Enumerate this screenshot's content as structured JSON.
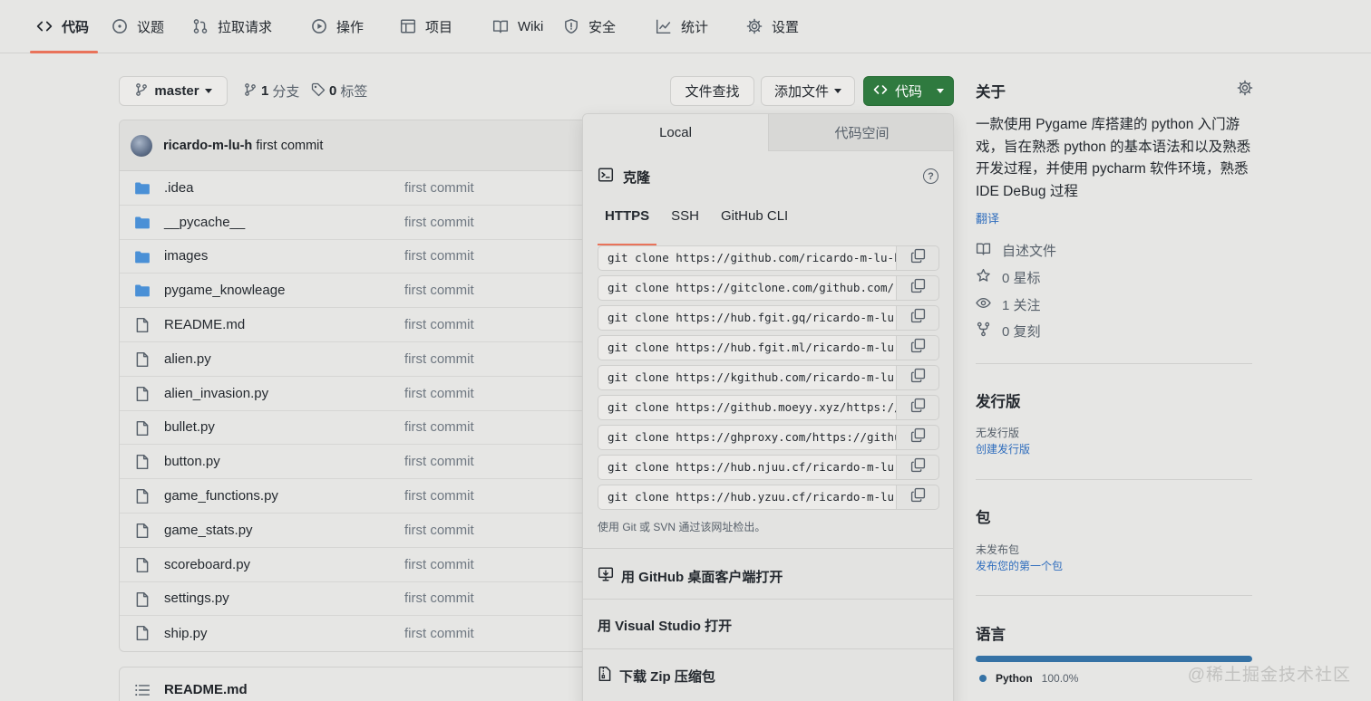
{
  "nav": {
    "tabs": [
      {
        "label": "代码",
        "icon": "code-icon",
        "active": true
      },
      {
        "label": "议题",
        "icon": "issue-icon"
      },
      {
        "label": "拉取请求",
        "icon": "pull-request-icon"
      },
      {
        "label": "操作",
        "icon": "play-icon"
      },
      {
        "label": "项目",
        "icon": "table-icon"
      },
      {
        "label": "Wiki",
        "icon": "book-icon"
      },
      {
        "label": "安全",
        "icon": "shield-icon"
      },
      {
        "label": "统计",
        "icon": "graph-icon"
      },
      {
        "label": "设置",
        "icon": "gear-icon"
      }
    ],
    "accent": "#e9735a"
  },
  "branchbar": {
    "branch": "master",
    "branches_count": "1",
    "branches_label": "分支",
    "tags_count": "0",
    "tags_label": "标签",
    "find_file": "文件查找",
    "add_file": "添加文件",
    "code_button": "代码"
  },
  "commit": {
    "author": "ricardo-m-lu-h",
    "message": "first commit"
  },
  "files": [
    {
      "name": ".idea",
      "type": "folder",
      "message": "first commit"
    },
    {
      "name": "__pycache__",
      "type": "folder",
      "message": "first commit"
    },
    {
      "name": "images",
      "type": "folder",
      "message": "first commit"
    },
    {
      "name": "pygame_knowleage",
      "type": "folder",
      "message": "first commit"
    },
    {
      "name": "README.md",
      "type": "file",
      "message": "first commit"
    },
    {
      "name": "alien.py",
      "type": "file",
      "message": "first commit"
    },
    {
      "name": "alien_invasion.py",
      "type": "file",
      "message": "first commit"
    },
    {
      "name": "bullet.py",
      "type": "file",
      "message": "first commit"
    },
    {
      "name": "button.py",
      "type": "file",
      "message": "first commit"
    },
    {
      "name": "game_functions.py",
      "type": "file",
      "message": "first commit"
    },
    {
      "name": "game_stats.py",
      "type": "file",
      "message": "first commit"
    },
    {
      "name": "scoreboard.py",
      "type": "file",
      "message": "first commit"
    },
    {
      "name": "settings.py",
      "type": "file",
      "message": "first commit"
    },
    {
      "name": "ship.py",
      "type": "file",
      "message": "first commit"
    }
  ],
  "readme": {
    "title": "README.md"
  },
  "clone": {
    "tab_local": "Local",
    "tab_codespace": "代码空间",
    "heading": "克隆",
    "help": "?",
    "protocols": [
      "HTTPS",
      "SSH",
      "GitHub CLI"
    ],
    "urls": [
      "git clone https://github.com/ricardo-m-lu-h/a",
      "git clone https://gitclone.com/github.com/ric",
      "git clone https://hub.fgit.gq/ricardo-m-lu-h/",
      "git clone https://hub.fgit.ml/ricardo-m-lu-h/",
      "git clone https://kgithub.com/ricardo-m-lu-h/",
      "git clone https://github.moeyy.xyz/https://gi",
      "git clone https://ghproxy.com/https://github.",
      "git clone https://hub.njuu.cf/ricardo-m-lu-h/",
      "git clone https://hub.yzuu.cf/ricardo-m-lu-h/"
    ],
    "note": "使用 Git 或 SVN 通过该网址检出。",
    "open_desktop": "用 GitHub 桌面客户端打开",
    "open_vs": "用 Visual Studio 打开",
    "download_zip": "下载 Zip 压缩包"
  },
  "about": {
    "title": "关于",
    "description": "一款使用 Pygame 库搭建的 python 入门游戏，旨在熟悉 python 的基本语法和以及熟悉开发过程，并使用 pycharm 软件环境，熟悉 IDE DeBug 过程",
    "translate": "翻译",
    "readme": "自述文件",
    "stars": "0 星标",
    "watchers": "1 关注",
    "forks": "0 复刻"
  },
  "releases": {
    "title": "发行版",
    "none": "无发行版",
    "create": "创建发行版"
  },
  "packages": {
    "title": "包",
    "none": "未发布包",
    "publish": "发布您的第一个包"
  },
  "languages": {
    "title": "语言",
    "name": "Python",
    "percent": "100.0%",
    "share": 1.0,
    "color": "#3572a5"
  },
  "watermark": "@稀土掘金技术社区"
}
